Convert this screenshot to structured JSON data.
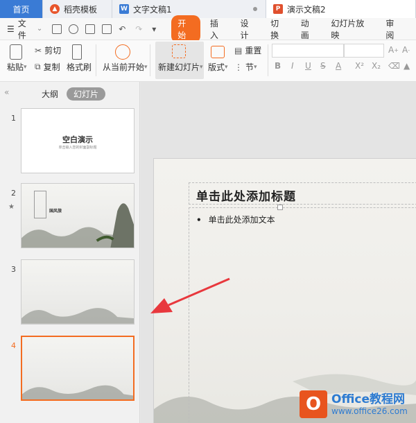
{
  "tabs": [
    {
      "label": "首页"
    },
    {
      "label": "稻壳模板"
    },
    {
      "label": "文字文稿1"
    },
    {
      "label": "演示文稿2"
    }
  ],
  "menu": {
    "file": "文件",
    "items": [
      "开始",
      "插入",
      "设计",
      "切换",
      "动画",
      "幻灯片放映",
      "审阅"
    ]
  },
  "ribbon": {
    "paste": "粘贴",
    "cut": "剪切",
    "copy": "复制",
    "format_painter": "格式刷",
    "from_current": "从当前开始",
    "new_slide": "新建幻灯片",
    "layout": "版式",
    "reset": "重置",
    "section": "节",
    "format_buttons": [
      "B",
      "I",
      "U",
      "S",
      "A",
      "X²",
      "X₂"
    ]
  },
  "panel": {
    "collapse": "«",
    "tab_outline": "大纲",
    "tab_slides": "幻灯片"
  },
  "thumbnails": [
    {
      "num": "1",
      "title": "空白演示",
      "subtitle": "单击输入您的封面副标题"
    },
    {
      "num": "2",
      "title": "国风旅"
    },
    {
      "num": "3"
    },
    {
      "num": "4"
    }
  ],
  "slide": {
    "title": "单击此处添加标题",
    "bullet": "单击此处添加文本"
  },
  "watermark": {
    "brand": "Office教程网",
    "url": "www.office26.com"
  },
  "colors": {
    "accent": "#f36c21",
    "home_tab": "#3a7bd5",
    "arrow": "#e8383d"
  }
}
